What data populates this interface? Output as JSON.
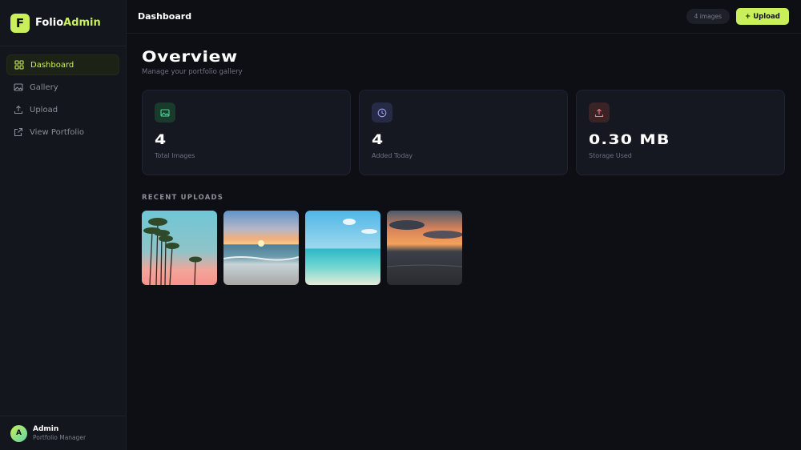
{
  "brand": {
    "logo_letter": "F",
    "name_main": "Folio",
    "name_accent": "Admin",
    "accent_color": "#c9ef5a"
  },
  "sidebar": {
    "items": [
      {
        "label": "Dashboard",
        "icon": "grid-icon",
        "active": true
      },
      {
        "label": "Gallery",
        "icon": "image-icon",
        "active": false
      },
      {
        "label": "Upload",
        "icon": "upload-icon",
        "active": false
      },
      {
        "label": "View Portfolio",
        "icon": "external-link-icon",
        "active": false
      }
    ]
  },
  "user": {
    "initial": "A",
    "name": "Admin",
    "role": "Portfolio Manager"
  },
  "topbar": {
    "title": "Dashboard",
    "count": "4 images",
    "upload_label": "+ Upload"
  },
  "main": {
    "title": "Overview",
    "subtitle": "Manage your portfolio gallery",
    "stats": [
      {
        "value": "4",
        "label": "Total Images",
        "icon": "image-icon",
        "color": "#4fd39a"
      },
      {
        "value": "4",
        "label": "Added Today",
        "icon": "clock-icon",
        "color": "#9a9cf5"
      },
      {
        "value": "0.30 MB",
        "label": "Storage Used",
        "icon": "upload-icon",
        "color": "#f07a86"
      }
    ],
    "recent_label": "RECENT UPLOADS",
    "recent": [
      {
        "subject": "palm-trees-sunset-photo"
      },
      {
        "subject": "beach-sunset-waves-photo"
      },
      {
        "subject": "tropical-turquoise-beach-photo"
      },
      {
        "subject": "ocean-sunset-clouds-photo"
      }
    ]
  }
}
